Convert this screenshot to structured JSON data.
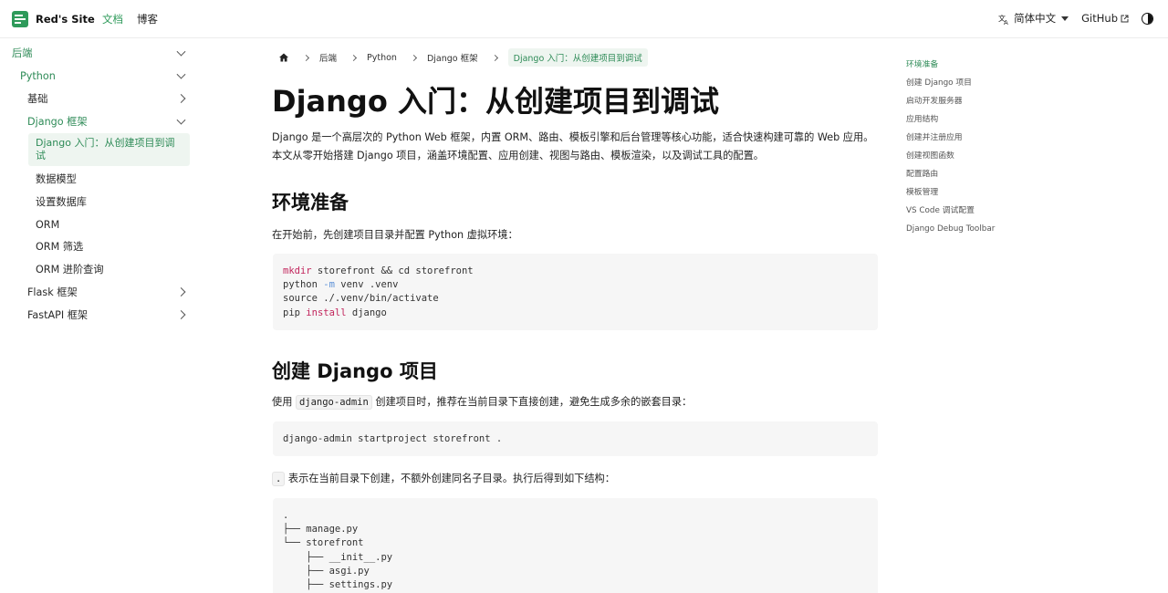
{
  "topnav": {
    "brand": "Red's Site",
    "links": {
      "docs": "文档",
      "blog": "博客"
    },
    "language": "简体中文",
    "github": "GitHub",
    "accent_color": "#2e9a5a"
  },
  "sidebar": {
    "items": [
      {
        "label": "后端",
        "level": 0,
        "chevron": "down",
        "green": true
      },
      {
        "label": "Python",
        "level": 1,
        "chevron": "down",
        "green": true
      },
      {
        "label": "基础",
        "level": 2,
        "chevron": "right",
        "green": false
      },
      {
        "label": "Django 框架",
        "level": 2,
        "chevron": "down",
        "green": true
      },
      {
        "label": "Django 入门：从创建项目到调试",
        "level": 3,
        "active": true
      },
      {
        "label": "数据模型",
        "level": 3
      },
      {
        "label": "设置数据库",
        "level": 3
      },
      {
        "label": "ORM",
        "level": 3
      },
      {
        "label": "ORM 筛选",
        "level": 3
      },
      {
        "label": "ORM 进阶查询",
        "level": 3
      },
      {
        "label": "Flask 框架",
        "level": 2,
        "chevron": "right"
      },
      {
        "label": "FastAPI 框架",
        "level": 2,
        "chevron": "right"
      }
    ]
  },
  "breadcrumb": {
    "items": [
      "后端",
      "Python",
      "Django 框架"
    ],
    "current": "Django 入门：从创建项目到调试"
  },
  "article": {
    "title": "Django 入门：从创建项目到调试",
    "intro": "Django 是一个高层次的 Python Web 框架，内置 ORM、路由、模板引擎和后台管理等核心功能，适合快速构建可靠的 Web 应用。本文从零开始搭建 Django 项目，涵盖环境配置、应用创建、视图与路由、模板渲染，以及调试工具的配置。",
    "section1": {
      "heading": "环境准备",
      "text": "在开始前，先创建项目目录并配置 Python 虚拟环境："
    },
    "section2": {
      "heading": "创建 Django 项目",
      "text_before": "使用",
      "inline_code": "django-admin",
      "text_after": "创建项目时，推荐在当前目录下直接创建，避免生成多余的嵌套目录：",
      "command": "django-admin startproject storefront .",
      "note_code": ".",
      "note_text": "表示在当前目录下创建，不额外创建同名子目录。执行后得到如下结构："
    },
    "tree": [
      ".",
      "├── manage.py",
      "└── storefront",
      "    ├── __init__.py",
      "    ├── asgi.py",
      "    ├── settings.py"
    ]
  },
  "toc": {
    "items": [
      "环境准备",
      "创建 Django 项目",
      "启动开发服务器",
      "应用结构",
      "创建并注册应用",
      "创建视图函数",
      "配置路由",
      "模板管理",
      "VS Code 调试配置",
      "Django Debug Toolbar"
    ]
  }
}
